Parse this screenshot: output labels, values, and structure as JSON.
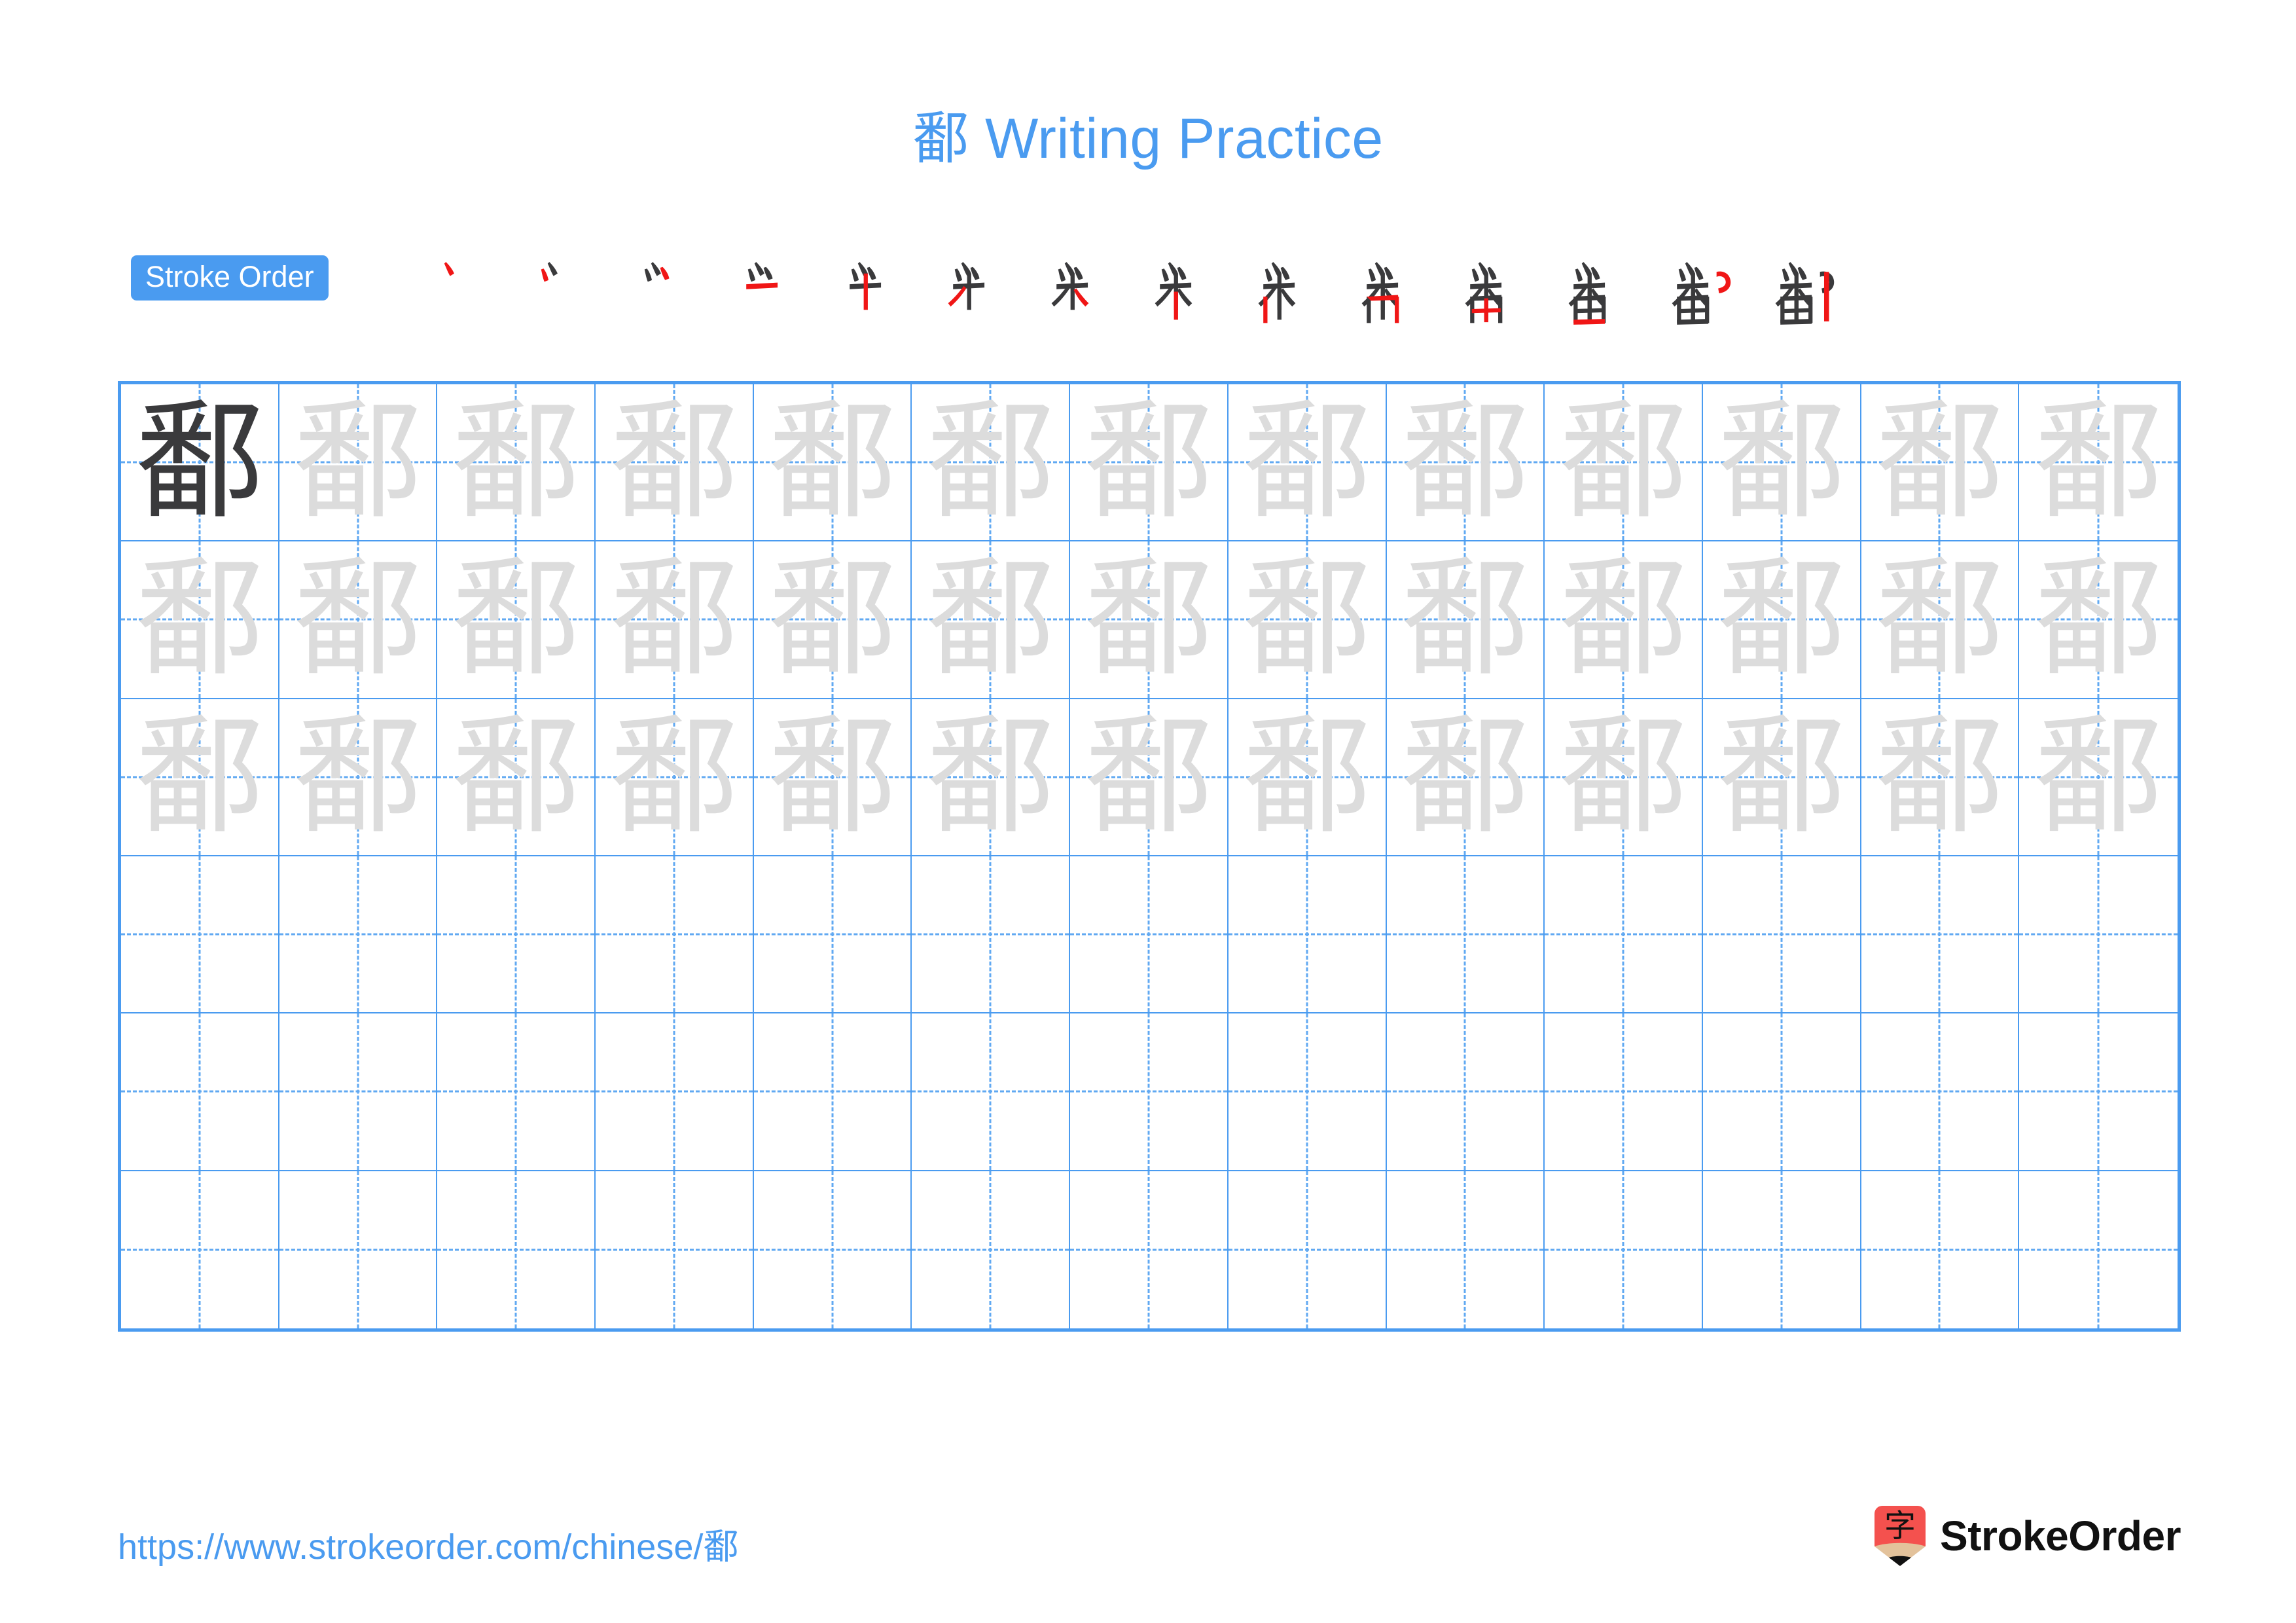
{
  "character": "鄱",
  "title": "鄱 Writing Practice",
  "colors": {
    "accent_blue": "#4a9bf0",
    "grid_line": "#4a9bf0",
    "guide_dash": "#61a9f2",
    "ink_dark": "#3a3a3c",
    "ink_ghost": "#dcdcdc",
    "stroke_new_red": "#f01616",
    "logo_red": "#f4514e",
    "logo_wood": "#e3c29b",
    "logo_text": "#111111"
  },
  "stroke_order": {
    "badge_label": "Stroke Order",
    "total_strokes": 14,
    "steps": [
      {
        "index": 1,
        "partial": "丿"
      },
      {
        "index": 2,
        "partial": "丷"
      },
      {
        "index": 3,
        "partial": "丷"
      },
      {
        "index": 4,
        "partial": "𠂉"
      },
      {
        "index": 5,
        "partial": "乎"
      },
      {
        "index": 6,
        "partial": "釆"
      },
      {
        "index": 7,
        "partial": "釆"
      },
      {
        "index": 8,
        "partial": "釆"
      },
      {
        "index": 9,
        "partial": "番"
      },
      {
        "index": 10,
        "partial": "番"
      },
      {
        "index": 11,
        "partial": "番"
      },
      {
        "index": 12,
        "partial": "番"
      },
      {
        "index": 13,
        "partial": "鄱"
      },
      {
        "index": 14,
        "partial": "鄱"
      }
    ]
  },
  "grid": {
    "columns": 13,
    "rows": 6,
    "cells": [
      [
        "dark",
        "ghost",
        "ghost",
        "ghost",
        "ghost",
        "ghost",
        "ghost",
        "ghost",
        "ghost",
        "ghost",
        "ghost",
        "ghost",
        "ghost"
      ],
      [
        "ghost",
        "ghost",
        "ghost",
        "ghost",
        "ghost",
        "ghost",
        "ghost",
        "ghost",
        "ghost",
        "ghost",
        "ghost",
        "ghost",
        "ghost"
      ],
      [
        "ghost",
        "ghost",
        "ghost",
        "ghost",
        "ghost",
        "ghost",
        "ghost",
        "ghost",
        "ghost",
        "ghost",
        "ghost",
        "ghost",
        "ghost"
      ],
      [
        "empty",
        "empty",
        "empty",
        "empty",
        "empty",
        "empty",
        "empty",
        "empty",
        "empty",
        "empty",
        "empty",
        "empty",
        "empty"
      ],
      [
        "empty",
        "empty",
        "empty",
        "empty",
        "empty",
        "empty",
        "empty",
        "empty",
        "empty",
        "empty",
        "empty",
        "empty",
        "empty"
      ],
      [
        "empty",
        "empty",
        "empty",
        "empty",
        "empty",
        "empty",
        "empty",
        "empty",
        "empty",
        "empty",
        "empty",
        "empty",
        "empty"
      ]
    ]
  },
  "footer": {
    "url": "https://www.strokeorder.com/chinese/鄱",
    "brand_name": "StrokeOrder",
    "brand_mark_char": "字"
  }
}
